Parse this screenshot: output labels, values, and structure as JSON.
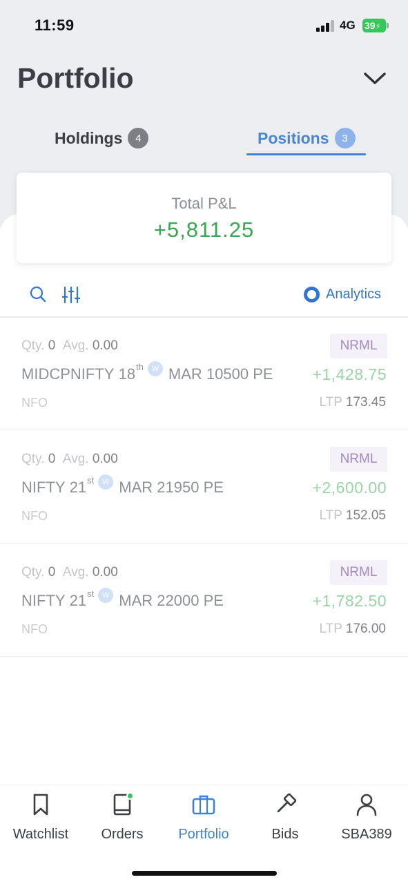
{
  "status_bar": {
    "time": "11:59",
    "network": "4G",
    "battery": "39"
  },
  "header": {
    "title": "Portfolio",
    "dropdown_icon": "chevron-down-icon"
  },
  "tabs": [
    {
      "label": "Holdings",
      "count": "4",
      "active": false
    },
    {
      "label": "Positions",
      "count": "3",
      "active": true
    }
  ],
  "pnl": {
    "label": "Total P&L",
    "value": "+5,811.25",
    "color": "#3aa652"
  },
  "toolbar": {
    "search_icon": "search-icon",
    "filter_icon": "sliders-icon",
    "analytics_label": "Analytics"
  },
  "positions": [
    {
      "qty_label": "Qty.",
      "qty": "0",
      "avg_label": "Avg.",
      "avg": "0.00",
      "product": "NRML",
      "underlying": "MIDCPNIFTY",
      "day": "18",
      "suffix": "th",
      "weekly": "W",
      "rest": "MAR 10500 PE",
      "pnl": "+1,428.75",
      "exchange": "NFO",
      "ltp_label": "LTP",
      "ltp": "173.45"
    },
    {
      "qty_label": "Qty.",
      "qty": "0",
      "avg_label": "Avg.",
      "avg": "0.00",
      "product": "NRML",
      "underlying": "NIFTY",
      "day": "21",
      "suffix": "st",
      "weekly": "W",
      "rest": "MAR 21950 PE",
      "pnl": "+2,600.00",
      "exchange": "NFO",
      "ltp_label": "LTP",
      "ltp": "152.05"
    },
    {
      "qty_label": "Qty.",
      "qty": "0",
      "avg_label": "Avg.",
      "avg": "0.00",
      "product": "NRML",
      "underlying": "NIFTY",
      "day": "21",
      "suffix": "st",
      "weekly": "W",
      "rest": "MAR 22000 PE",
      "pnl": "+1,782.50",
      "exchange": "NFO",
      "ltp_label": "LTP",
      "ltp": "176.00"
    }
  ],
  "bottom_nav": [
    {
      "label": "Watchlist",
      "icon": "bookmark-icon",
      "active": false
    },
    {
      "label": "Orders",
      "icon": "book-icon",
      "active": false,
      "dot": true
    },
    {
      "label": "Portfolio",
      "icon": "briefcase-icon",
      "active": true
    },
    {
      "label": "Bids",
      "icon": "gavel-icon",
      "active": false
    },
    {
      "label": "SBA389",
      "icon": "user-icon",
      "active": false
    }
  ],
  "colors": {
    "accent": "#3f82d8",
    "profit": "#3aa652",
    "product_badge": "#a28bc0"
  }
}
